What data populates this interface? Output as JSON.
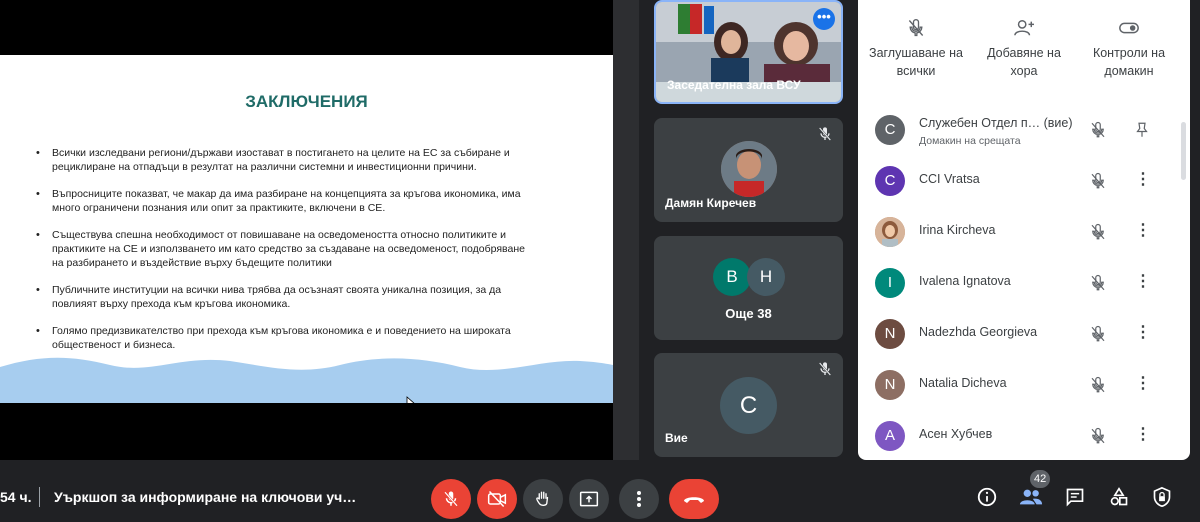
{
  "slide": {
    "title": "ЗАКЛЮЧЕНИЯ",
    "bullets": [
      "Всички изследвани региони/държави изостават в постигането на целите на ЕС за събиране и рециклиране на отпадъци в резултат на различни системни и инвестиционни причини.",
      "Въпросниците показват, че макар да има разбиране на концепцията за кръгова икономика, има много ограничени познания или опит за практиките, включени в СЕ.",
      "Съществува спешна необходимост от повишаване на осведомеността относно политиките и практиките на СЕ и използването им като средство за създаване на осведоменост, подобряване на разбирането и въздействие върху бъдещите политики",
      "Публичните институции на всички нива трябва да осъзнаят своята уникална позиция, за да повлияят върху прехода към кръгова икономика.",
      "Голямо предизвикателство при прехода към кръгова икономика е и поведението на широката общественост и бизнеса."
    ]
  },
  "tiles": {
    "video": {
      "name": "Заседателна зала ВСУ"
    },
    "person": {
      "name": "Дамян Киречев"
    },
    "group": {
      "initial_a": "В",
      "initial_b": "Н",
      "label": "Още 38"
    },
    "self": {
      "initial": "C",
      "name": "Вие"
    }
  },
  "panel": {
    "controls": {
      "mute_all": "Заглушаване на всички",
      "add_people": "Добавяне на хора",
      "host_controls": "Контроли на домакин"
    },
    "people": [
      {
        "initial": "C",
        "name": "Служебен Отдел п…",
        "suffix": "(вие)",
        "sub": "Домакин на срещата",
        "color": "#5f6368"
      },
      {
        "initial": "C",
        "name": "CCI Vratsa",
        "color": "#5e35b1"
      },
      {
        "initial": "",
        "name": "Irina Kircheva",
        "color": "#c98f6b"
      },
      {
        "initial": "I",
        "name": "Ivalena Ignatova",
        "color": "#00897b"
      },
      {
        "initial": "N",
        "name": "Nadezhda Georgieva",
        "color": "#6d4c41"
      },
      {
        "initial": "N",
        "name": "Natalia Dicheva",
        "color": "#8d6e63"
      },
      {
        "initial": "A",
        "name": "Асен Хубчев",
        "color": "#7e57c2"
      }
    ]
  },
  "bottom": {
    "time": "54 ч.",
    "meeting_title": "Уъркшоп за информиране на ключови уч…",
    "participants_count": "42"
  },
  "colors": {
    "accent": "#1a73e8",
    "end_call": "#ea4335",
    "slide_title": "#1f6b67",
    "wave": "#a7cdef"
  },
  "icons": [
    "mic-off-icon",
    "camera-off-icon",
    "hand-icon",
    "present-icon",
    "more-icon",
    "end-call-icon",
    "info-icon",
    "people-icon",
    "chat-icon",
    "activities-icon",
    "lock-icon",
    "pin-icon",
    "add-person-icon",
    "toggle-icon"
  ]
}
